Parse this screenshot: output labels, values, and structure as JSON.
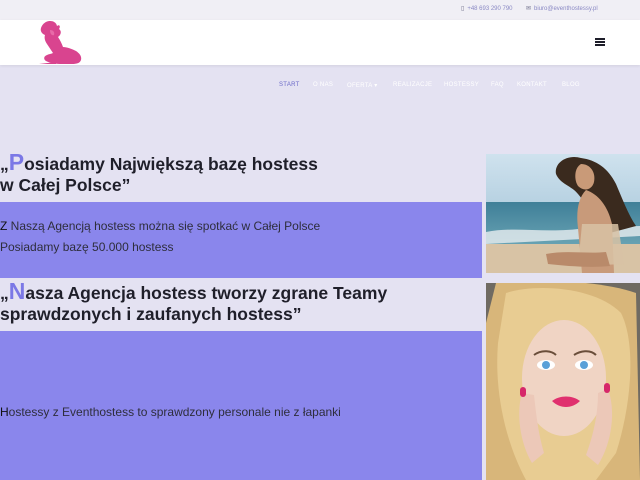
{
  "topbar": {
    "phone": "+48 693 290 790",
    "phone_icon": "phone-icon",
    "email": "biuro@eventhostessy.pl",
    "email_icon": "envelope-icon"
  },
  "header": {
    "logo_icon": "silhouette-logo-icon",
    "menu_icon": "hamburger-menu-icon"
  },
  "nav": {
    "items": [
      {
        "label": "START"
      },
      {
        "label": "O NAS"
      },
      {
        "label": "OFERTA ▾"
      },
      {
        "label": "REALIZACJE"
      },
      {
        "label": "HOSTESSY"
      },
      {
        "label": "FAQ"
      },
      {
        "label": "KONTAKT"
      },
      {
        "label": "BLOG"
      }
    ]
  },
  "section1": {
    "quote_open": "„",
    "big_letter": "P",
    "line1_rest": "osiadamy Największą bazę hostess",
    "line2": "w Całej Polsce”",
    "para1_first": "Z",
    "para1_rest": " Naszą Agencją hostess można się spotkać w Całej Polsce",
    "para2": "Posiadamy bazę 50.000 hostess"
  },
  "section2": {
    "quote_open": "„",
    "big_letter": "N",
    "line1_rest": "asza Agencja hostess tworzy zgrane Teamy",
    "line2": "sprawdzonych i zaufanych hostess”",
    "para_first": "H",
    "para_rest": "ostessy z Eventhostess to sprawdzony personale nie z łapanki"
  },
  "colors": {
    "accent": "#7b78e6",
    "panel": "#8a86ec",
    "page_bg": "#e4e2f2",
    "logo_pink": "#d9448f"
  }
}
